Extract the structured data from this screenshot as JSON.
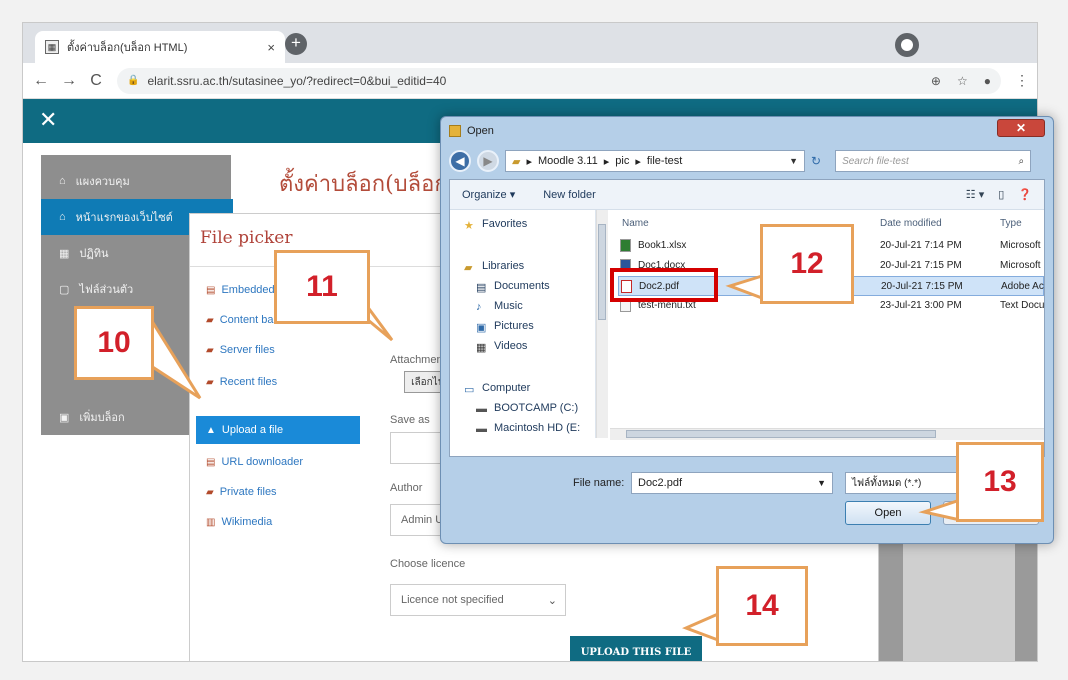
{
  "browser": {
    "tab_title": "ตั้งค่าบล็อก(บล็อก HTML)",
    "tab_close": "×",
    "new_tab": "+",
    "url": "elarit.ssru.ac.th/sutasinee_yo/?redirect=0&bui_editid=40",
    "back": "←",
    "forward": "→",
    "reload": "C",
    "zoom_icon": "⊕",
    "star_icon": "☆",
    "account_icon": "●",
    "menu_icon": "⋮"
  },
  "moodle": {
    "close": "✕",
    "page_title": "ตั้งค่าบล็อก(บล็อก",
    "sidebar": [
      {
        "icon": "⌂",
        "label": "แผงควบคุม"
      },
      {
        "icon": "⌂",
        "label": "หน้าแรกของเว็บไซต์"
      },
      {
        "icon": "▦",
        "label": "ปฏิทิน"
      },
      {
        "icon": "▢",
        "label": "ไฟล์ส่วนตัว"
      },
      {
        "icon": "▣",
        "label": "เพิ่มบล็อก"
      }
    ]
  },
  "picker": {
    "title": "File picker",
    "repos": [
      {
        "icon": "▤",
        "label": "Embedded files"
      },
      {
        "icon": "▰",
        "label": "Content bank"
      },
      {
        "icon": "▰",
        "label": "Server files"
      },
      {
        "icon": "▰",
        "label": "Recent files"
      },
      {
        "icon": "▲",
        "label": "Upload a file"
      },
      {
        "icon": "▤",
        "label": "URL downloader"
      },
      {
        "icon": "▰",
        "label": "Private files"
      },
      {
        "icon": "▥",
        "label": "Wikimedia"
      }
    ],
    "attachment_label": "Attachment",
    "choose_button": "เลือกไฟล์",
    "save_as_label": "Save as",
    "author_label": "Author",
    "author_value": "Admin User",
    "licence_label": "Choose licence",
    "licence_value": "Licence not specified",
    "upload_button": "UPLOAD THIS FILE"
  },
  "dialog": {
    "title": "Open",
    "close": "✕",
    "path": [
      "Moodle 3.11",
      "pic",
      "file-test"
    ],
    "search_placeholder": "Search file-test",
    "organize": "Organize ▾",
    "new_folder": "New folder",
    "nav": {
      "favorites": "Favorites",
      "libraries": "Libraries",
      "documents": "Documents",
      "music": "Music",
      "pictures": "Pictures",
      "videos": "Videos",
      "computer": "Computer",
      "bootcamp": "BOOTCAMP (C:)",
      "macintosh": "Macintosh HD (E:"
    },
    "columns": {
      "name": "Name",
      "date": "Date modified",
      "type": "Type"
    },
    "files": [
      {
        "name": "Book1.xlsx",
        "date": "20-Jul-21 7:14 PM",
        "type": "Microsoft"
      },
      {
        "name": "Doc1.docx",
        "date": "20-Jul-21 7:15 PM",
        "type": "Microsoft"
      },
      {
        "name": "Doc2.pdf",
        "date": "20-Jul-21 7:15 PM",
        "type": "Adobe Ac"
      },
      {
        "name": "test-menu.txt",
        "date": "23-Jul-21 3:00 PM",
        "type": "Text Docu"
      }
    ],
    "file_name_label": "File name:",
    "file_name_value": "Doc2.pdf",
    "file_type": "ไฟล์ทั้งหมด (*.*)",
    "open_button": "Open"
  },
  "callouts": {
    "c10": "10",
    "c11": "11",
    "c12": "12",
    "c13": "13",
    "c14": "14"
  },
  "colors": {
    "moodle_teal": "#0f6b82",
    "selected_blue": "#1a8ad8",
    "callout_border": "#e7a15a",
    "callout_text": "#d2202a",
    "highlight_red": "#d40000"
  }
}
